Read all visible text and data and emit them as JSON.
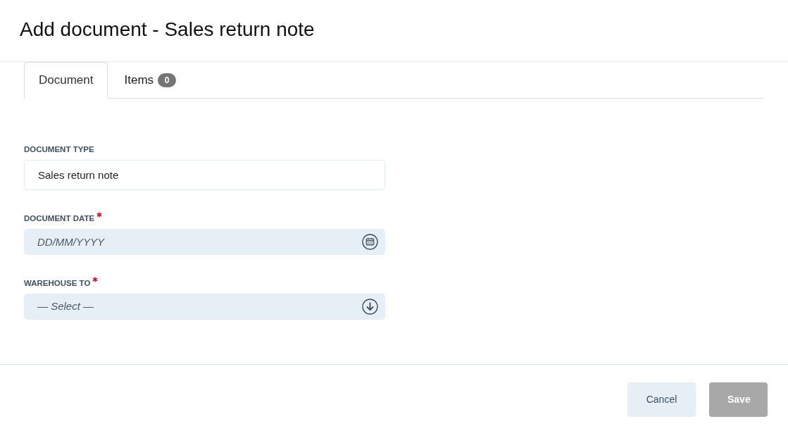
{
  "dialog": {
    "title": "Add document - Sales return note"
  },
  "tabs": [
    {
      "label": "Document",
      "selected": true
    },
    {
      "label": "Items",
      "badge": "0",
      "selected": false
    }
  ],
  "fields": [
    {
      "kind": "text",
      "label": "DOCUMENT TYPE",
      "required": false,
      "value": "Sales return note"
    },
    {
      "kind": "date",
      "label": "DOCUMENT DATE",
      "required": true,
      "placeholder": "DD/MM/YYYY"
    },
    {
      "kind": "select",
      "label": "WAREHOUSE TO",
      "required": true,
      "placeholder": "— Select —"
    }
  ],
  "buttons": [
    {
      "label": "Cancel",
      "kind": "secondary",
      "disabled": false
    },
    {
      "label": "Save",
      "kind": "primary",
      "disabled": true
    }
  ]
}
